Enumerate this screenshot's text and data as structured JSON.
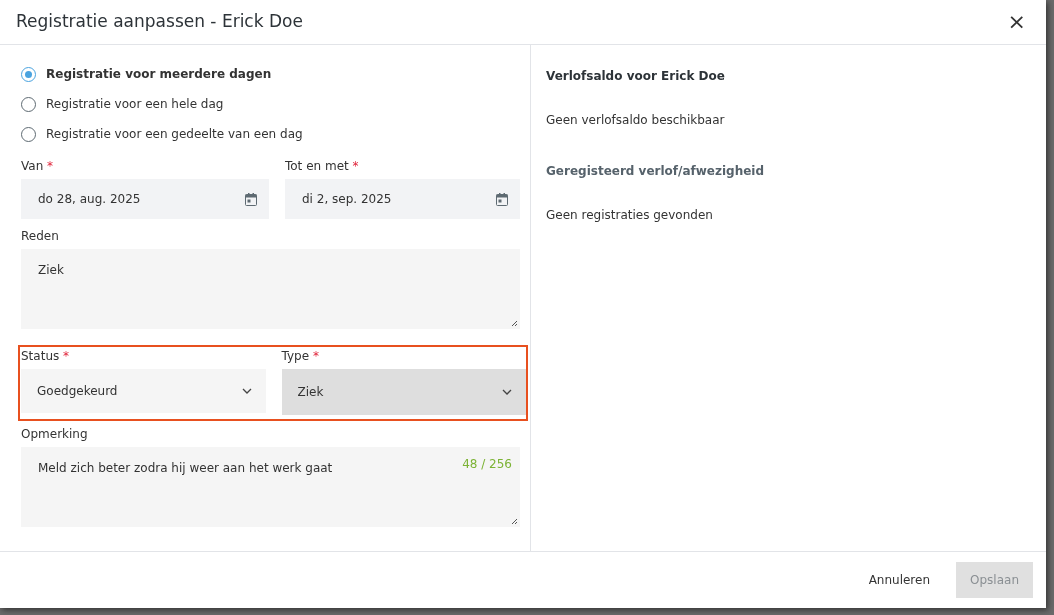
{
  "dialog": {
    "title": "Registratie aanpassen - Erick Doe",
    "close_label": "×"
  },
  "registration_options": [
    {
      "label": "Registratie voor meerdere dagen",
      "selected": true
    },
    {
      "label": "Registratie voor een hele dag",
      "selected": false
    },
    {
      "label": "Registratie voor een gedeelte van een dag",
      "selected": false
    }
  ],
  "date_fields": [
    {
      "label": "Van",
      "required_mark": "*",
      "value": "do 28, aug. 2025"
    },
    {
      "label": "Tot en met",
      "required_mark": "*",
      "value": "di 2, sep. 2025"
    }
  ],
  "reason": {
    "label": "Reden",
    "value": "Ziek"
  },
  "select_group": {
    "highlighted": true,
    "selects": [
      {
        "label": "Status",
        "required_mark": "*",
        "value": "Goedgekeurd",
        "active": false
      },
      {
        "label": "Type",
        "required_mark": "*",
        "value": "Ziek",
        "active": true
      }
    ]
  },
  "remark": {
    "label": "Opmerking",
    "value": "Meld zich beter zodra hij weer aan het werk gaat",
    "counter": "48 / 256"
  },
  "side_panel": [
    {
      "kind": "heading",
      "text": "Verlofsaldo voor Erick Doe"
    },
    {
      "kind": "text",
      "text": "Geen verlofsaldo beschikbaar"
    },
    {
      "kind": "subheading",
      "text": "Geregisteerd verlof/afwezigheid"
    },
    {
      "kind": "text",
      "text": "Geen registraties gevonden"
    }
  ],
  "footer_buttons": [
    {
      "label": "Annuleren",
      "kind": "link"
    },
    {
      "label": "Opslaan",
      "kind": "primary",
      "disabled": true
    }
  ]
}
